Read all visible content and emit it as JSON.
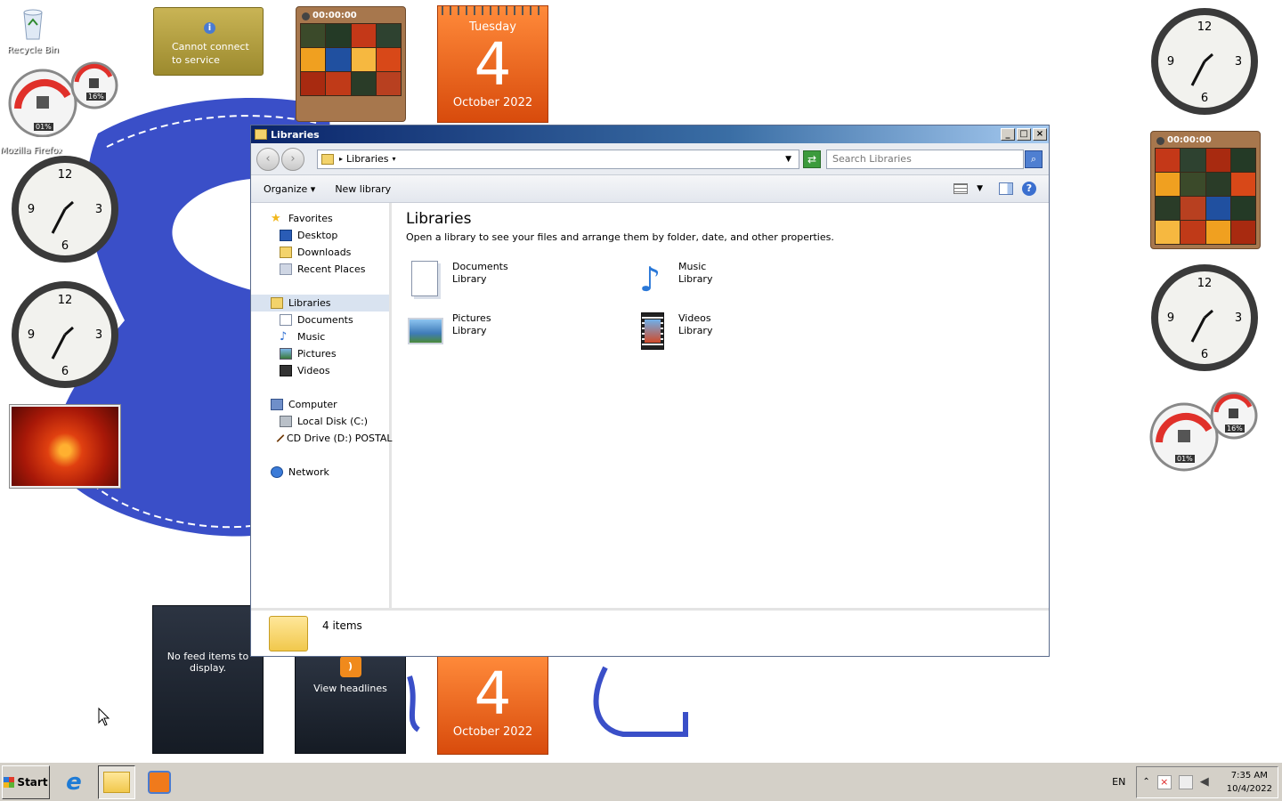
{
  "desktop": {
    "icons": [
      {
        "label": "Recycle Bin"
      },
      {
        "label": "Mozilla Firefox"
      }
    ]
  },
  "gadgets": {
    "weather": {
      "message": "Cannot connect to service"
    },
    "puzzle_timer": "00:00:00",
    "calendar": {
      "weekday": "Tuesday",
      "day": "4",
      "month_year": "October 2022"
    },
    "meter": {
      "cpu": "01%",
      "memory": "16%"
    },
    "feed": {
      "message": "No feed items to display."
    },
    "headlines": {
      "label": "View headlines"
    }
  },
  "window": {
    "title": "Libraries",
    "address": {
      "crumb": "Libraries"
    },
    "search": {
      "placeholder": "Search Libraries"
    },
    "toolbar": {
      "organize": "Organize",
      "new_library": "New library"
    },
    "nav": {
      "favorites": {
        "label": "Favorites",
        "items": [
          "Desktop",
          "Downloads",
          "Recent Places"
        ]
      },
      "libraries": {
        "label": "Libraries",
        "items": [
          "Documents",
          "Music",
          "Pictures",
          "Videos"
        ]
      },
      "computer": {
        "label": "Computer",
        "items": [
          "Local Disk (C:)",
          "CD Drive (D:) POSTAL"
        ]
      },
      "network": {
        "label": "Network"
      }
    },
    "content": {
      "heading": "Libraries",
      "description": "Open a library to see your files and arrange them by folder, date, and other properties.",
      "libraries": [
        {
          "name": "Documents",
          "type": "Library",
          "icon": "documents-library-icon"
        },
        {
          "name": "Music",
          "type": "Library",
          "icon": "music-library-icon"
        },
        {
          "name": "Pictures",
          "type": "Library",
          "icon": "pictures-library-icon"
        },
        {
          "name": "Videos",
          "type": "Library",
          "icon": "videos-library-icon"
        }
      ]
    },
    "status": {
      "count": "4 items"
    }
  },
  "taskbar": {
    "start": "Start",
    "language": "EN",
    "time": "7:35 AM",
    "date": "10/4/2022"
  },
  "colors": {
    "calendar": "#e8620f",
    "title_bar": "#0a246a",
    "taskbar": "#d4d0c8",
    "wallpaper_shape": "#3a4fc8"
  }
}
